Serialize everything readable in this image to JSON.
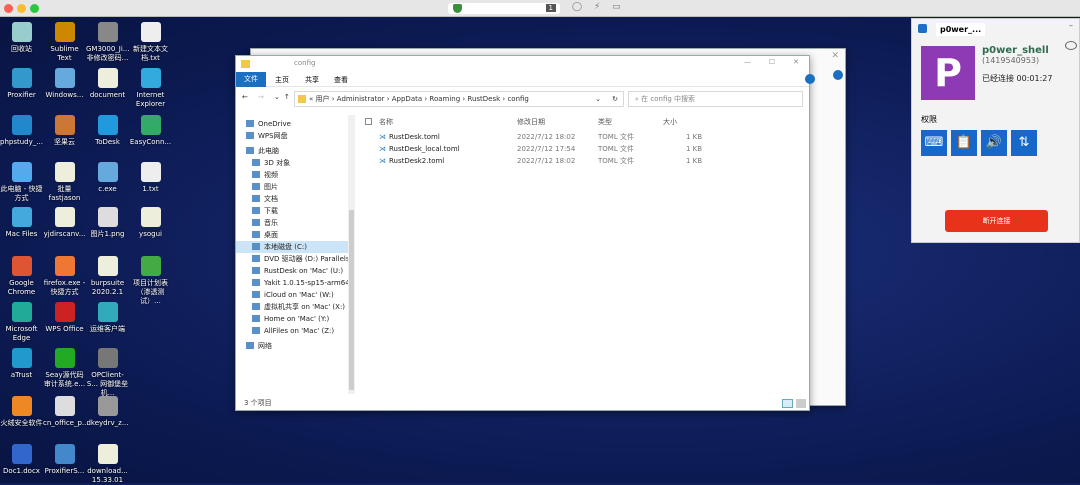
{
  "mac": {
    "tab_badge": "1"
  },
  "desktop_icons": [
    {
      "label": "回收站",
      "color": "#9cc"
    },
    {
      "label": "Sublime Text",
      "color": "#c80"
    },
    {
      "label": "GM3000_Ji... 非修改密码...",
      "color": "#888"
    },
    {
      "label": "新建文本文档.txt",
      "color": "#eee"
    },
    {
      "label": "Proxifier",
      "color": "#39c"
    },
    {
      "label": "Windows...",
      "color": "#6ad"
    },
    {
      "label": "document",
      "color": "#eed"
    },
    {
      "label": "Internet Explorer",
      "color": "#3ad"
    },
    {
      "label": "phpstudy_...",
      "color": "#28c"
    },
    {
      "label": "坚果云",
      "color": "#c73"
    },
    {
      "label": "ToDesk",
      "color": "#29d"
    },
    {
      "label": "EasyConn...",
      "color": "#3a6"
    },
    {
      "label": "此电脑 - 快捷方式",
      "color": "#5ae"
    },
    {
      "label": "批量 fastjason",
      "color": "#eed"
    },
    {
      "label": "c.exe",
      "color": "#6ad"
    },
    {
      "label": "1.txt",
      "color": "#eee"
    },
    {
      "label": "Mac Files",
      "color": "#4ad"
    },
    {
      "label": "yjdirscanv...",
      "color": "#eed"
    },
    {
      "label": "图片1.png",
      "color": "#ddd"
    },
    {
      "label": "ysogui",
      "color": "#eed"
    },
    {
      "label": "Google Chrome",
      "color": "#d53"
    },
    {
      "label": "firefox.exe - 快捷方式",
      "color": "#e73"
    },
    {
      "label": "burpsuite 2020.2.1",
      "color": "#eed"
    },
    {
      "label": "项目计划表（渗透测试）...",
      "color": "#4a4"
    },
    {
      "label": "Microsoft Edge",
      "color": "#2a9"
    },
    {
      "label": "WPS Office",
      "color": "#c22"
    },
    {
      "label": "运维客户端",
      "color": "#3ab"
    },
    null,
    {
      "label": "aTrust",
      "color": "#29c"
    },
    {
      "label": "Seay源代码审计系统.e...",
      "color": "#2a2"
    },
    {
      "label": "OPClient-S... 网御堡垒机...",
      "color": "#777"
    },
    null,
    {
      "label": "火绒安全软件",
      "color": "#e82"
    },
    {
      "label": "cn_office_p...",
      "color": "#ddd"
    },
    {
      "label": "dkeydrv_z...",
      "color": "#999"
    },
    null,
    {
      "label": "Doc1.docx",
      "color": "#36c"
    },
    {
      "label": "ProxifierS...",
      "color": "#48c"
    },
    {
      "label": "download... 15.33.01",
      "color": "#eed"
    },
    null
  ],
  "explorer": {
    "title": "config",
    "ribbon_tabs": [
      "文件",
      "主页",
      "共享",
      "查看"
    ],
    "breadcrumb": [
      "«",
      "用户",
      "Administrator",
      "AppData",
      "Roaming",
      "RustDesk",
      "config"
    ],
    "search_placeholder": "在 config 中搜索",
    "nav": [
      {
        "label": "OneDrive",
        "icon": "cloud-icon",
        "indent": 0
      },
      {
        "label": "WPS网盘",
        "icon": "cloud-icon",
        "indent": 0
      },
      {
        "label": "此电脑",
        "icon": "computer-icon",
        "indent": 0
      },
      {
        "label": "3D 对象",
        "icon": "cube-icon",
        "indent": 1
      },
      {
        "label": "视频",
        "icon": "video-icon",
        "indent": 1
      },
      {
        "label": "图片",
        "icon": "picture-icon",
        "indent": 1
      },
      {
        "label": "文档",
        "icon": "document-icon",
        "indent": 1
      },
      {
        "label": "下载",
        "icon": "download-icon",
        "indent": 1
      },
      {
        "label": "音乐",
        "icon": "music-icon",
        "indent": 1
      },
      {
        "label": "桌面",
        "icon": "desktop-icon",
        "indent": 1
      },
      {
        "label": "本地磁盘 (C:)",
        "icon": "drive-icon",
        "indent": 1,
        "selected": true
      },
      {
        "label": "DVD 驱动器 (D:) Parallels",
        "icon": "dvd-icon",
        "indent": 1
      },
      {
        "label": "RustDesk on 'Mac' (U:)",
        "icon": "network-drive-icon",
        "indent": 1
      },
      {
        "label": "Yakit 1.0.15-sp15-arm64",
        "icon": "network-drive-icon",
        "indent": 1
      },
      {
        "label": "iCloud on 'Mac' (W:)",
        "icon": "network-drive-icon",
        "indent": 1
      },
      {
        "label": "虚拟机共享 on 'Mac' (X:)",
        "icon": "network-drive-icon",
        "indent": 1
      },
      {
        "label": "Home on 'Mac' (Y:)",
        "icon": "network-drive-icon",
        "indent": 1
      },
      {
        "label": "AllFiles on 'Mac' (Z:)",
        "icon": "network-drive-icon",
        "indent": 1
      },
      {
        "label": "网络",
        "icon": "network-icon",
        "indent": 0
      }
    ],
    "columns": [
      "名称",
      "修改日期",
      "类型",
      "大小"
    ],
    "files": [
      {
        "name": "RustDesk.toml",
        "date": "2022/7/12 18:02",
        "type": "TOML 文件",
        "size": "1 KB"
      },
      {
        "name": "RustDesk_local.toml",
        "date": "2022/7/12 17:54",
        "type": "TOML 文件",
        "size": "1 KB"
      },
      {
        "name": "RustDesk2.toml",
        "date": "2022/7/12 18:02",
        "type": "TOML 文件",
        "size": "1 KB"
      }
    ],
    "status": "3 个项目"
  },
  "rustdesk": {
    "tab": "p0wer_...",
    "avatar_letter": "P",
    "avatar_color": "#8e3ab5",
    "name": "p0wer_shell",
    "id": "(1419540953)",
    "connected": "已经连接 00:01:27",
    "permissions_label": "权限",
    "permissions": [
      "keyboard-mouse-icon",
      "clipboard-icon",
      "audio-icon",
      "file-transfer-icon"
    ],
    "disconnect": "断开连接",
    "disconnect_color": "#e8321a"
  }
}
